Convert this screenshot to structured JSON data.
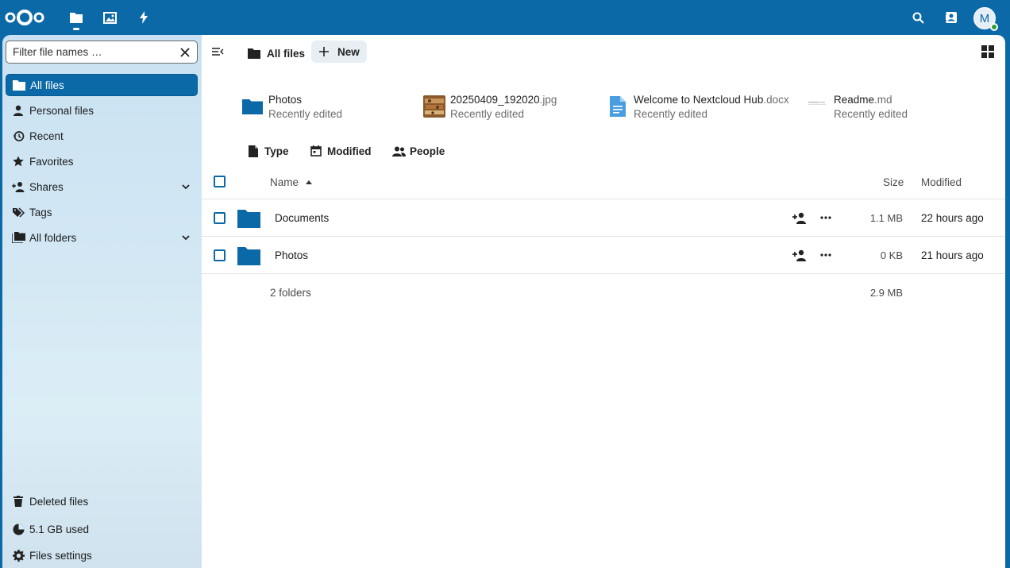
{
  "header": {
    "avatar_initial": "M",
    "colors": {
      "brand": "#0b69a8",
      "online": "#2d9b3a"
    }
  },
  "sidebar": {
    "filter_placeholder": "Filter file names …",
    "items": [
      {
        "label": "All files",
        "icon": "folder-icon",
        "active": true
      },
      {
        "label": "Personal files",
        "icon": "person-icon"
      },
      {
        "label": "Recent",
        "icon": "history-icon"
      },
      {
        "label": "Favorites",
        "icon": "star-icon"
      },
      {
        "label": "Shares",
        "icon": "share-icon",
        "expandable": true
      },
      {
        "label": "Tags",
        "icon": "tag-icon"
      },
      {
        "label": "All folders",
        "icon": "folders-icon",
        "expandable": true
      }
    ],
    "footer": [
      {
        "label": "Deleted files",
        "icon": "trash-icon"
      },
      {
        "label": "5.1 GB used",
        "icon": "pie-chart-icon"
      },
      {
        "label": "Files settings",
        "icon": "gear-icon"
      }
    ]
  },
  "toolbar": {
    "breadcrumb": "All files",
    "new_label": "New"
  },
  "recent": [
    {
      "name": "Photos",
      "ext": "",
      "subtitle": "Recently edited",
      "icon": "folder-icon"
    },
    {
      "name": "20250409_192020",
      "ext": ".jpg",
      "subtitle": "Recently edited",
      "icon": "image-thumbnail"
    },
    {
      "name": "Welcome to Nextcloud Hub",
      "ext": ".docx",
      "subtitle": "Recently edited",
      "icon": "document-icon"
    },
    {
      "name": "Readme",
      "ext": ".md",
      "subtitle": "Recently edited",
      "icon": "text-file-thumbnail"
    }
  ],
  "filters": [
    {
      "label": "Type",
      "icon": "file-icon"
    },
    {
      "label": "Modified",
      "icon": "calendar-icon"
    },
    {
      "label": "People",
      "icon": "people-icon"
    }
  ],
  "table": {
    "columns": {
      "name": "Name",
      "size": "Size",
      "modified": "Modified"
    },
    "rows": [
      {
        "name": "Documents",
        "size": "1.1 MB",
        "modified": "22 hours ago"
      },
      {
        "name": "Photos",
        "size": "0 KB",
        "modified": "21 hours ago"
      }
    ],
    "summary": {
      "count": "2 folders",
      "size": "2.9 MB"
    }
  }
}
